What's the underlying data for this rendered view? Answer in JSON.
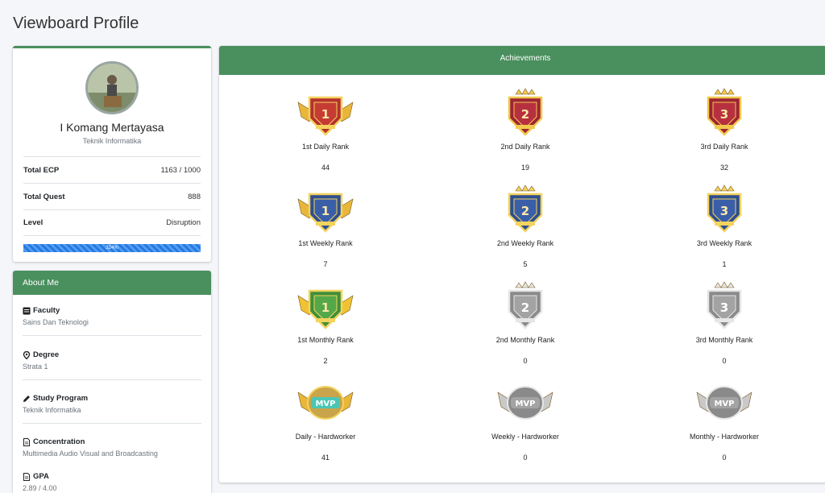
{
  "page": {
    "title": "Viewboard Profile"
  },
  "profile": {
    "name": "I Komang Mertayasa",
    "program": "Teknik Informatika",
    "stats": [
      {
        "label": "Total ECP",
        "value": "1163 / 1000"
      },
      {
        "label": "Total Quest",
        "value": "888"
      },
      {
        "label": "Level",
        "value": "Disruption"
      }
    ],
    "progress": {
      "percent": 100,
      "text": "324%"
    }
  },
  "about": {
    "title": "About Me",
    "items": [
      {
        "label": "Faculty",
        "value": "Sains Dan Teknologi",
        "icon": "book-icon"
      },
      {
        "label": "Degree",
        "value": "Strata 1",
        "icon": "map-marker-icon"
      },
      {
        "label": "Study Program",
        "value": "Teknik Informatika",
        "icon": "pencil-icon"
      },
      {
        "label": "Concentration",
        "value": "Multimedia Audio Visual and Broadcasting",
        "icon": "file-icon"
      },
      {
        "label": "GPA",
        "value": "2.89 / 4.00",
        "icon": "file-icon"
      }
    ]
  },
  "achievements": {
    "title": "Achievements",
    "items": [
      {
        "label": "1st Daily Rank",
        "count": "44",
        "tier": "gold",
        "num": "1",
        "style": "wings"
      },
      {
        "label": "2nd Daily Rank",
        "count": "19",
        "tier": "red",
        "num": "2",
        "style": "shield"
      },
      {
        "label": "3rd Daily Rank",
        "count": "32",
        "tier": "red",
        "num": "3",
        "style": "shield"
      },
      {
        "label": "1st Weekly Rank",
        "count": "7",
        "tier": "blue",
        "num": "1",
        "style": "wings"
      },
      {
        "label": "2nd Weekly Rank",
        "count": "5",
        "tier": "blue",
        "num": "2",
        "style": "shield"
      },
      {
        "label": "3rd Weekly Rank",
        "count": "1",
        "tier": "blue",
        "num": "3",
        "style": "shield"
      },
      {
        "label": "1st Monthly Rank",
        "count": "2",
        "tier": "green",
        "num": "1",
        "style": "wings"
      },
      {
        "label": "2nd Monthly Rank",
        "count": "0",
        "tier": "silver",
        "num": "2",
        "style": "shield"
      },
      {
        "label": "3rd Monthly Rank",
        "count": "0",
        "tier": "silver",
        "num": "3",
        "style": "shield"
      },
      {
        "label": "Daily - Hardworker",
        "count": "41",
        "tier": "mvp",
        "num": "MVP",
        "style": "mvp"
      },
      {
        "label": "Weekly - Hardworker",
        "count": "0",
        "tier": "silver",
        "num": "MVP",
        "style": "mvp"
      },
      {
        "label": "Monthly - Hardworker",
        "count": "0",
        "tier": "silver",
        "num": "MVP",
        "style": "mvp"
      }
    ]
  },
  "colors": {
    "accent": "#4a8f5e",
    "progress": "#1f7ae6"
  }
}
